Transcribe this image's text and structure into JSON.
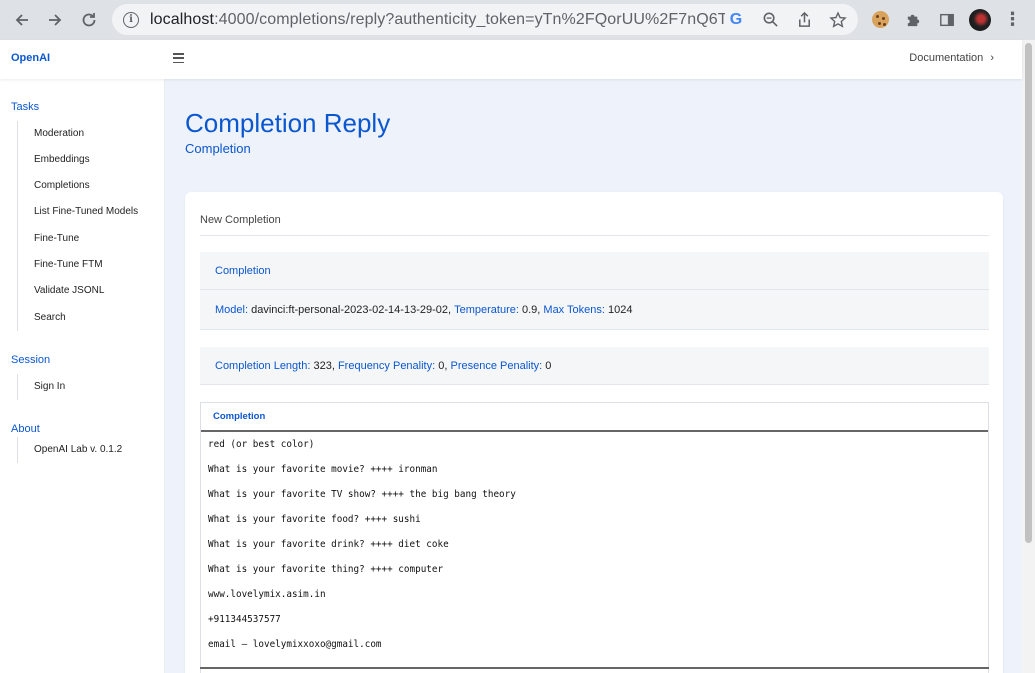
{
  "browser": {
    "url_host": "localhost",
    "url_rest": ":4000/completions/reply?authenticity_token=yTn%2FQorUU%2F7nQ6TS7..."
  },
  "app": {
    "brand": "OpenAI",
    "docs_link": "Documentation",
    "docs_chevron": "›"
  },
  "sidebar": {
    "tasks_title": "Tasks",
    "tasks": [
      "Moderation",
      "Embeddings",
      "Completions",
      "List Fine-Tuned Models",
      "Fine-Tune",
      "Fine-Tune FTM",
      "Validate JSONL",
      "Search"
    ],
    "session_title": "Session",
    "session_items": [
      "Sign In"
    ],
    "about_title": "About",
    "about_items": [
      "OpenAI Lab v. 0.1.2"
    ]
  },
  "page": {
    "title": "Completion Reply",
    "subtitle": "Completion"
  },
  "card": {
    "heading": "New Completion",
    "panel1": {
      "title": "Completion",
      "model_label": "Model:",
      "model_value": "davinci:ft-personal-2023-02-14-13-29-02,",
      "temp_label": "Temperature:",
      "temp_value": "0.9,",
      "max_label": "Max Tokens:",
      "max_value": "1024"
    },
    "panel2": {
      "len_label": "Completion Length:",
      "len_value": "323,",
      "freq_label": "Frequency Penality:",
      "freq_value": "0,",
      "pres_label": "Presence Penality:",
      "pres_value": "0"
    },
    "table": {
      "header": "Completion",
      "lines": [
        "red (or best color)",
        "What is your favorite movie? ++++ ironman",
        "What is your favorite TV show? ++++ the big bang theory",
        "What is your favorite food? ++++ sushi",
        "What is your favorite drink? ++++ diet coke",
        "What is your favorite thing? ++++ computer",
        "www.lovelymix.asim.in",
        "+911344537577",
        "email — lovelymixxoxo@gmail.com"
      ]
    }
  }
}
